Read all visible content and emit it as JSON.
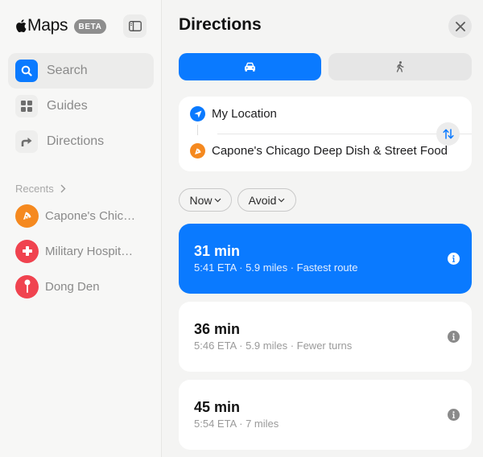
{
  "app": {
    "name": "Maps",
    "badge": "BETA"
  },
  "sidebar": {
    "items": [
      {
        "label": "Search",
        "icon": "search-icon",
        "active": true
      },
      {
        "label": "Guides",
        "icon": "grid-icon",
        "active": false
      },
      {
        "label": "Directions",
        "icon": "turn-right-arrow-icon",
        "active": false
      }
    ],
    "recents_label": "Recents",
    "recents": [
      {
        "label": "Capone's Chic…",
        "icon": "pizza-icon",
        "color": "#f5891f"
      },
      {
        "label": "Military Hospit…",
        "icon": "medical-cross-icon",
        "color": "#f0434f"
      },
      {
        "label": "Dong Den",
        "icon": "pin-icon",
        "color": "#f0434f"
      }
    ]
  },
  "panel": {
    "title": "Directions",
    "modes": [
      {
        "name": "driving",
        "icon": "car-icon",
        "selected": true
      },
      {
        "name": "walking",
        "icon": "walking-icon",
        "selected": false
      }
    ],
    "from": "My Location",
    "to": "Capone's Chicago Deep Dish & Street Food",
    "filters": {
      "time": "Now",
      "avoid": "Avoid"
    },
    "routes": [
      {
        "time": "31 min",
        "meta": "5:41 ETA · 5.9 miles · Fastest route",
        "selected": true
      },
      {
        "time": "36 min",
        "meta": "5:46 ETA · 5.9 miles · Fewer turns",
        "selected": false
      },
      {
        "time": "45 min",
        "meta": "5:54 ETA · 7 miles",
        "selected": false
      }
    ]
  },
  "colors": {
    "accent": "#0a7aff",
    "pizza": "#f5891f",
    "red": "#f0434f"
  }
}
